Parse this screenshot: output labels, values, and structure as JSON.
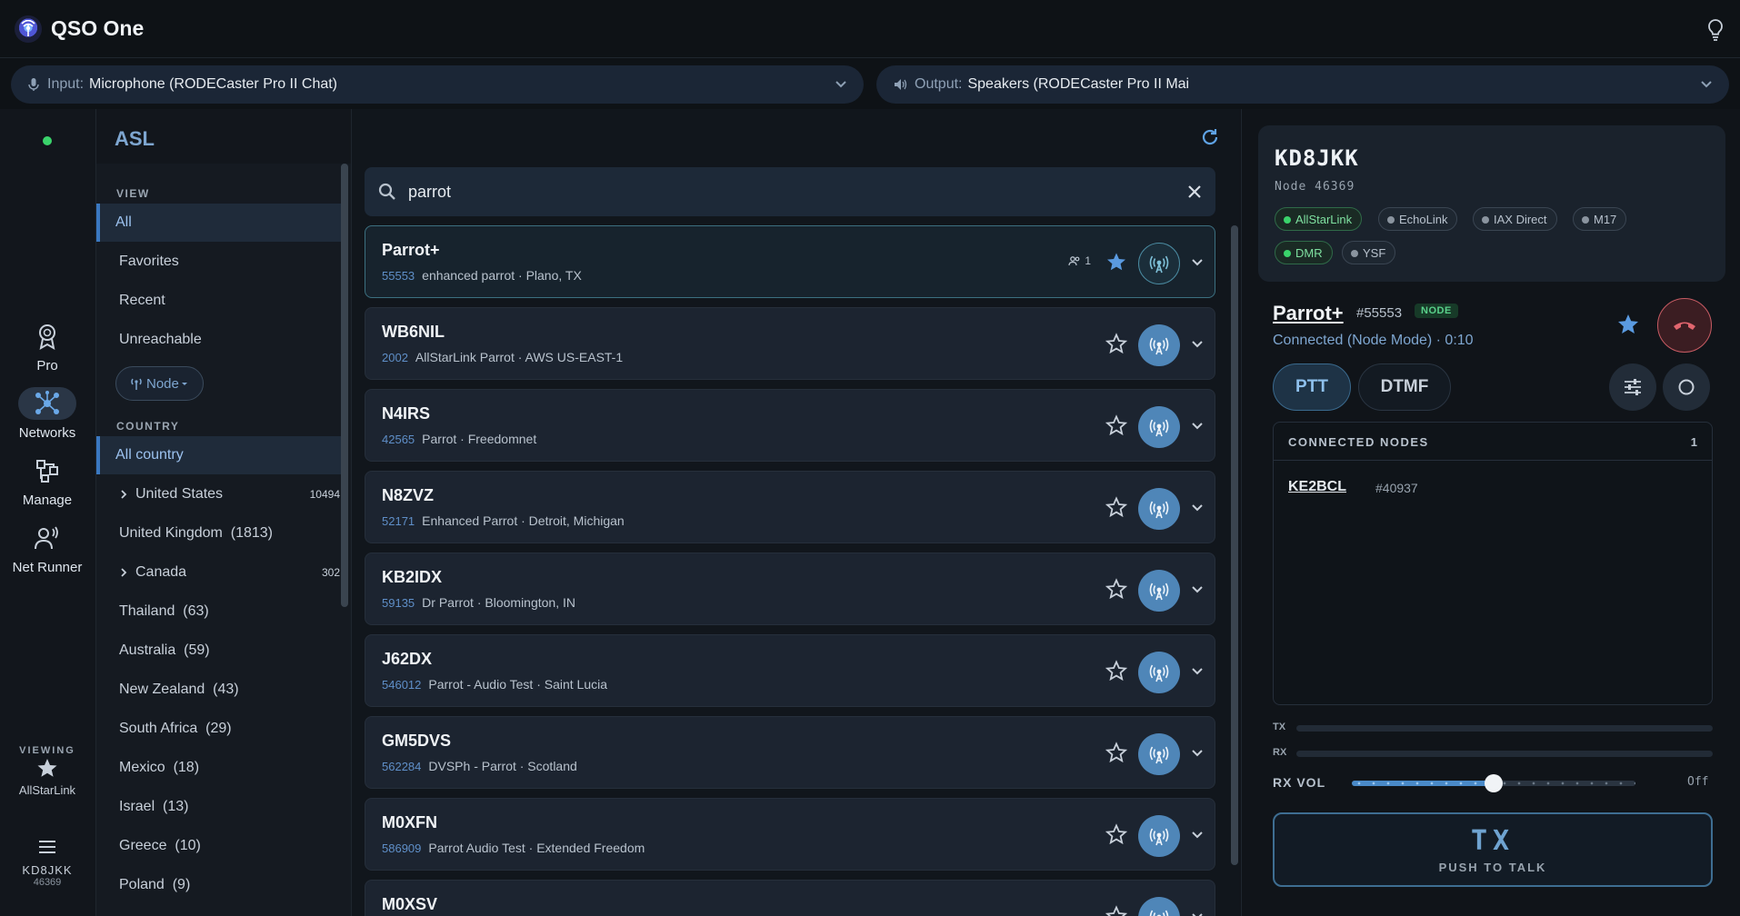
{
  "app": {
    "title": "QSO One"
  },
  "devices": {
    "input_label": "Input:",
    "input_value": "Microphone (RODECaster Pro II Chat)",
    "output_label": "Output:",
    "output_value": "Speakers (RODECaster Pro II Mai"
  },
  "rail": {
    "items": [
      {
        "label": "Pro"
      },
      {
        "label": "Networks"
      },
      {
        "label": "Manage"
      },
      {
        "label": "Net Runner"
      }
    ],
    "viewing_caption": "VIEWING",
    "viewing_network": "AllStarLink",
    "user_call": "KD8JKK",
    "user_node": "46369"
  },
  "sidebar": {
    "title": "ASL",
    "view_heading": "VIEW",
    "views": [
      "All",
      "Favorites",
      "Recent",
      "Unreachable"
    ],
    "node_filter": "Node",
    "country_heading": "COUNTRY",
    "all_country": "All country",
    "countries": [
      {
        "name": "United States",
        "count": "10494",
        "expand": true
      },
      {
        "name": "United Kingdom  (1813)",
        "count": "",
        "expand": false
      },
      {
        "name": "Canada",
        "count": "302",
        "expand": true
      },
      {
        "name": "Thailand  (63)",
        "count": "",
        "expand": false
      },
      {
        "name": "Australia  (59)",
        "count": "",
        "expand": false
      },
      {
        "name": "New Zealand  (43)",
        "count": "",
        "expand": false
      },
      {
        "name": "South Africa  (29)",
        "count": "",
        "expand": false
      },
      {
        "name": "Mexico  (18)",
        "count": "",
        "expand": false
      },
      {
        "name": "Israel  (13)",
        "count": "",
        "expand": false
      },
      {
        "name": "Greece  (10)",
        "count": "",
        "expand": false
      },
      {
        "name": "Poland  (9)",
        "count": "",
        "expand": false
      },
      {
        "name": "Italy  (9)",
        "count": "",
        "expand": false
      }
    ]
  },
  "search": {
    "value": "parrot"
  },
  "results": [
    {
      "call": "Parrot+",
      "node": "55553",
      "desc": "enhanced parrot · Plano, TX",
      "users": "1",
      "favorite": true,
      "active": true
    },
    {
      "call": "WB6NIL",
      "node": "2002",
      "desc": "AllStarLink Parrot · AWS US-EAST-1",
      "favorite": false,
      "active": false
    },
    {
      "call": "N4IRS",
      "node": "42565",
      "desc": "Parrot · Freedomnet",
      "favorite": false,
      "active": false
    },
    {
      "call": "N8ZVZ",
      "node": "52171",
      "desc": "Enhanced Parrot · Detroit, Michigan",
      "favorite": false,
      "active": false
    },
    {
      "call": "KB2IDX",
      "node": "59135",
      "desc": "Dr Parrot · Bloomington, IN",
      "favorite": false,
      "active": false
    },
    {
      "call": "J62DX",
      "node": "546012",
      "desc": "Parrot - Audio Test · Saint Lucia",
      "favorite": false,
      "active": false
    },
    {
      "call": "GM5DVS",
      "node": "562284",
      "desc": "DVSPh - Parrot · Scotland",
      "favorite": false,
      "active": false
    },
    {
      "call": "M0XFN",
      "node": "586909",
      "desc": "Parrot Audio Test · Extended Freedom",
      "favorite": false,
      "active": false
    },
    {
      "call": "M0XSV",
      "node": "",
      "desc": "",
      "favorite": false,
      "active": false
    }
  ],
  "profile": {
    "call": "KD8JKK",
    "node": "Node 46369",
    "networks": [
      {
        "name": "AllStarLink",
        "on": true
      },
      {
        "name": "EchoLink",
        "on": false
      },
      {
        "name": "IAX Direct",
        "on": false
      },
      {
        "name": "M17",
        "on": false
      },
      {
        "name": "DMR",
        "on": true
      },
      {
        "name": "YSF",
        "on": false
      }
    ]
  },
  "connection": {
    "name": "Parrot+",
    "node": "#55553",
    "badge": "NODE",
    "status": "Connected (Node Mode) · 0:10",
    "ptt_label": "PTT",
    "dtmf_label": "DTMF",
    "nodes_title": "CONNECTED NODES",
    "nodes_count": "1",
    "nodes": [
      {
        "call": "KE2BCL",
        "node": "#40937"
      }
    ],
    "tx_label": "TX",
    "rx_label": "RX",
    "rx_vol_label": "RX VOL",
    "rx_vol_value": "Off",
    "rx_vol_level": 0.5,
    "tx_button_big": "TX",
    "tx_button_small": "PUSH TO TALK"
  },
  "colors": {
    "accent": "#4f86b8",
    "online": "#3ad36b",
    "hangup": "#c75b63"
  }
}
